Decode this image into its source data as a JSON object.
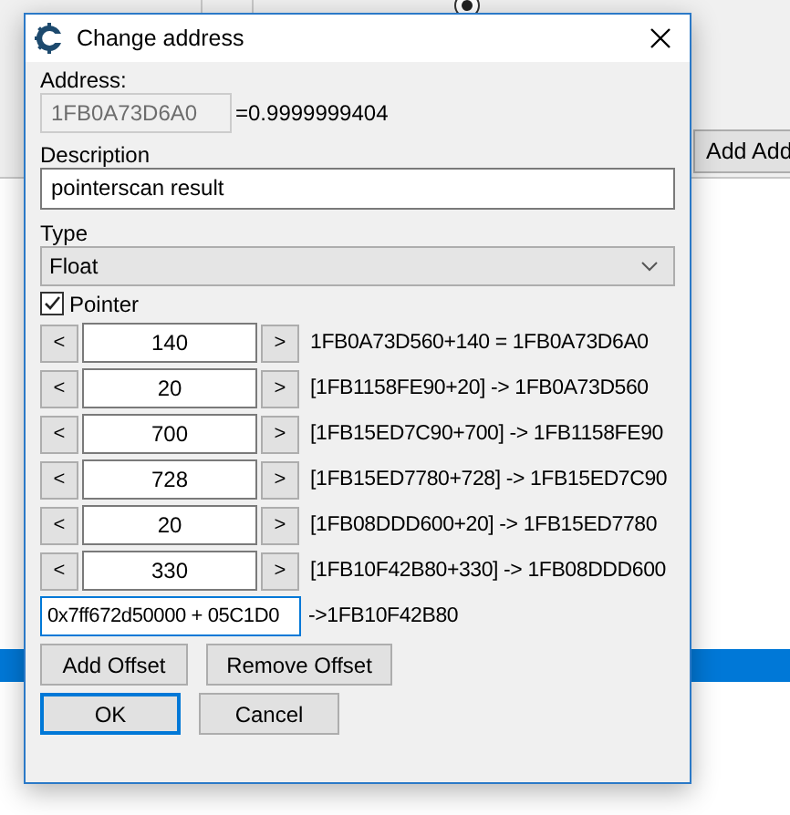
{
  "background": {
    "radio": {
      "selected": true
    },
    "button": "Add Add"
  },
  "dialog": {
    "title": "Change address",
    "address_label": "Address:",
    "address": "1FB0A73D6A0",
    "value": "=0.9999999404",
    "description_label": "Description",
    "description": "pointerscan result",
    "type_label": "Type",
    "type": "Float",
    "pointer": {
      "label": "Pointer",
      "checked": true
    },
    "offsets": [
      {
        "dec": "<",
        "value": "140",
        "inc": ">",
        "result": "1FB0A73D560+140 = 1FB0A73D6A0"
      },
      {
        "dec": "<",
        "value": "20",
        "inc": ">",
        "result": "[1FB1158FE90+20] -> 1FB0A73D560"
      },
      {
        "dec": "<",
        "value": "700",
        "inc": ">",
        "result": "[1FB15ED7C90+700] -> 1FB1158FE90"
      },
      {
        "dec": "<",
        "value": "728",
        "inc": ">",
        "result": "[1FB15ED7780+728] -> 1FB15ED7C90"
      },
      {
        "dec": "<",
        "value": "20",
        "inc": ">",
        "result": "[1FB08DDD600+20] -> 1FB15ED7780"
      },
      {
        "dec": "<",
        "value": "330",
        "inc": ">",
        "result": "[1FB10F42B80+330] -> 1FB08DDD600"
      }
    ],
    "base": {
      "value": "0x7ff672d50000 + 05C1D0",
      "result": "->1FB10F42B80"
    },
    "offset_buttons": [
      "Add Offset",
      "Remove Offset"
    ],
    "buttons": [
      {
        "label": "OK",
        "default": true
      },
      {
        "label": "Cancel",
        "default": false
      }
    ]
  }
}
